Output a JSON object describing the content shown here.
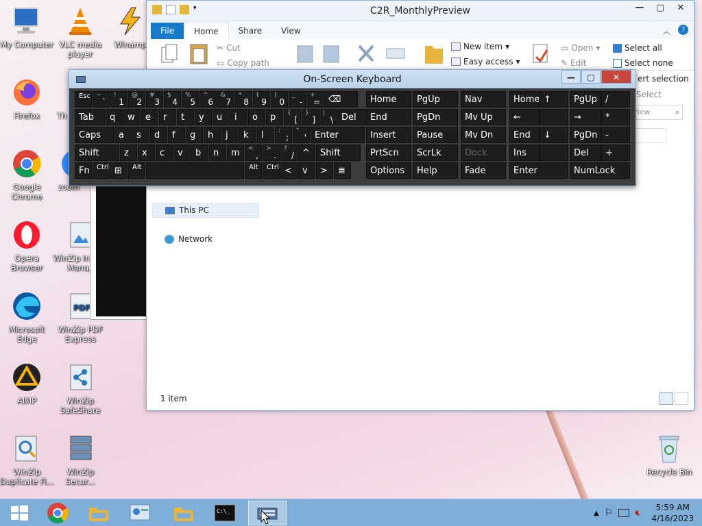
{
  "desktop": {
    "icons": [
      {
        "label": "My Computer"
      },
      {
        "label": "VLC media player"
      },
      {
        "label": "Winamp"
      },
      {
        "label": "Firefox"
      },
      {
        "label": "Th"
      },
      {
        "label": "Google Chrome"
      },
      {
        "label": "zoom"
      },
      {
        "label": "Opera Browser"
      },
      {
        "label": "WinZip Image Manag"
      },
      {
        "label": "Microsoft Edge"
      },
      {
        "label": "WinZip PDF Express"
      },
      {
        "label": "AIMP"
      },
      {
        "label": "WinZip SafeShare"
      },
      {
        "label": "WinZip Duplicate Fi..."
      },
      {
        "label": "WinZip Secur..."
      },
      {
        "label": "Recycle Bin"
      }
    ]
  },
  "explorer": {
    "title": "C2R_MonthlyPreview",
    "tabs": [
      "File",
      "Home",
      "Share",
      "View"
    ],
    "ribbon": {
      "cut": "Cut",
      "copy_path": "Copy path",
      "new_item": "New item",
      "easy_access": "Easy access",
      "open": "Open",
      "edit": "Edit",
      "select_all": "Select all",
      "select_none": "Select none",
      "invert_selection": "ert selection",
      "select_group": "Select"
    },
    "search_placeholder": "view",
    "nav": {
      "this_pc": "This PC",
      "network": "Network"
    },
    "status": "1 item"
  },
  "osk": {
    "title": "On-Screen Keyboard",
    "rows": [
      [
        "Esc",
        "`~",
        "1!",
        "2@",
        "3#",
        "4$",
        "5%",
        "6^",
        "7&",
        "8*",
        "9(",
        "0)",
        "-_",
        "=+",
        "⌫"
      ],
      [
        "Tab",
        "q",
        "w",
        "e",
        "r",
        "t",
        "y",
        "u",
        "i",
        "o",
        "p",
        "[{",
        "]}",
        "\\|",
        "Del"
      ],
      [
        "Caps",
        "a",
        "s",
        "d",
        "f",
        "g",
        "h",
        "j",
        "k",
        "l",
        ";:",
        "'\"",
        "Enter"
      ],
      [
        "Shift",
        "z",
        "x",
        "c",
        "v",
        "b",
        "n",
        "m",
        ",<",
        ".>",
        "/?",
        "^",
        "Shift"
      ],
      [
        "Fn",
        "Ctrl",
        "⊞",
        "Alt",
        "",
        "Alt",
        "Ctrl",
        "<",
        "v",
        ">",
        "≣"
      ]
    ],
    "nav_keys": [
      "Home",
      "PgUp",
      "Nav",
      "End",
      "PgDn",
      "Mv Up",
      "Insert",
      "Pause",
      "Mv Dn",
      "PrtScn",
      "ScrLk",
      "Dock",
      "Options",
      "Help",
      "Fade"
    ],
    "numpad": [
      "Home",
      "↑",
      "PgUp",
      "/",
      "←",
      "",
      "→",
      "*",
      "End",
      "↓",
      "PgDn",
      "-",
      "Ins",
      "",
      "Del",
      "+",
      "Enter",
      "",
      "NumLock",
      ""
    ]
  },
  "taskbar": {
    "time": "5:59 AM",
    "date": "4/16/2023"
  }
}
